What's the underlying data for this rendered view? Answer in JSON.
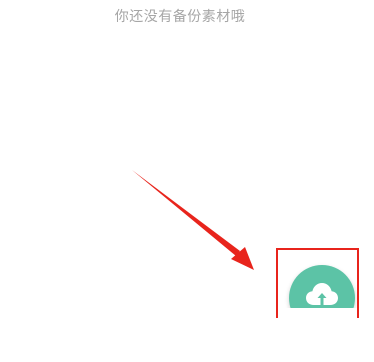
{
  "empty_state": {
    "message": "你还没有备份素材哦"
  },
  "fab": {
    "icon": "cloud-upload-icon",
    "color": "#5cc3a6"
  },
  "annotation": {
    "arrow_color": "#e8241c",
    "box_color": "#e8241c"
  }
}
